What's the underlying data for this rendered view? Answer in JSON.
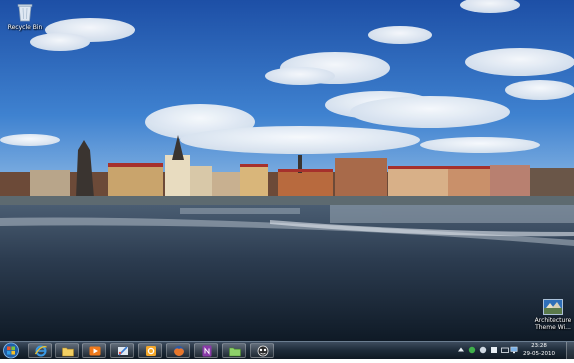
{
  "desktop": {
    "icons": [
      {
        "label": "Recycle Bin",
        "icon": "recycle-bin-icon"
      },
      {
        "label": "Architecture Theme Wi...",
        "icon": "theme-icon"
      }
    ]
  },
  "taskbar": {
    "start": {
      "icon": "windows-orb-icon"
    },
    "pinned": [
      {
        "icon": "internet-explorer-icon"
      },
      {
        "icon": "file-explorer-icon"
      },
      {
        "icon": "media-player-icon"
      },
      {
        "icon": "paint-icon"
      },
      {
        "icon": "outlook-icon"
      },
      {
        "icon": "firefox-icon"
      },
      {
        "icon": "onenote-icon"
      },
      {
        "icon": "folder-icon"
      },
      {
        "icon": "app-icon"
      }
    ],
    "tray": {
      "icons": [
        "arrow-up-icon",
        "network-icon",
        "volume-icon",
        "flag-icon",
        "keyboard-icon",
        "display-icon"
      ],
      "time": "23:28",
      "date": "29-05-2010"
    }
  },
  "colors": {
    "taskbar": "#1d2a38",
    "sky": "#3b78c4",
    "water": "#2a3a4e"
  }
}
